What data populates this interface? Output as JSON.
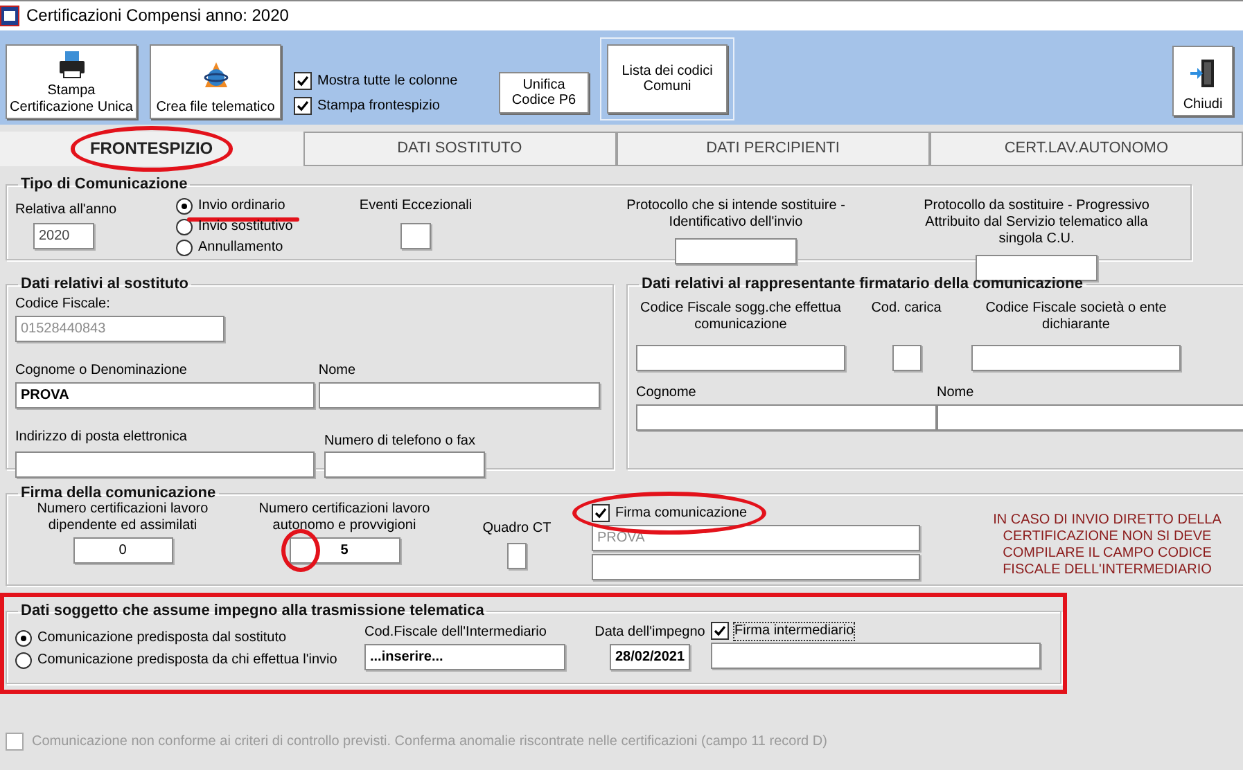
{
  "window": {
    "title": "Certificazioni Compensi anno: 2020"
  },
  "toolbar": {
    "buttons": [
      {
        "kind": "printer",
        "label": "Stampa Certificazione Unica"
      },
      {
        "kind": "telematic",
        "label": "Crea file telematico"
      }
    ],
    "options": [
      {
        "label": "Mostra tutte le colonne",
        "checked": true
      },
      {
        "label": "Stampa frontespizio",
        "checked": true
      }
    ],
    "actions": [
      {
        "label": "Unifica Codice P6"
      },
      {
        "label": "Lista dei codici Comuni"
      }
    ],
    "close": {
      "label": "Chiudi"
    }
  },
  "tabs": [
    {
      "label": "FRONTESPIZIO",
      "selected": true,
      "circled": true
    },
    {
      "label": "DATI SOSTITUTO",
      "selected": false
    },
    {
      "label": "DATI PERCIPIENTI",
      "selected": false
    },
    {
      "label": "CERT.LAV.AUTONOMO",
      "selected": false
    }
  ],
  "tipo_comunicazione": {
    "title": "Tipo di Comunicazione",
    "anno": {
      "label": "Relativa all'anno",
      "value": "2020"
    },
    "radios": [
      {
        "label": "Invio ordinario",
        "selected": true,
        "underlined": true
      },
      {
        "label": "Invio sostitutivo",
        "selected": false
      },
      {
        "label": "Annullamento",
        "selected": false
      }
    ],
    "eventi": {
      "label": "Eventi Eccezionali"
    },
    "protocollo": {
      "label": "Protocollo che si intende sostituire - Identificativo dell'invio"
    },
    "progressivo": {
      "label": "Protocollo da sostituire - Progressivo Attribuito dal Servizio telematico alla singola C.U."
    }
  },
  "sostituto": {
    "title": "Dati relativi al sostituto",
    "fields": [
      {
        "label": "Codice Fiscale:",
        "value": "01528440843",
        "disabled": true,
        "bold": false
      },
      {
        "label": "Cognome o Denominazione",
        "value": "PROVA",
        "disabled": false,
        "bold": true
      },
      {
        "label": "Nome"
      },
      {
        "label": "Indirizzo di posta elettronica"
      },
      {
        "label": "Numero di telefono o fax"
      }
    ]
  },
  "rappresentante": {
    "title": "Dati relativi al rappresentante firmatario della comunicazione",
    "fields": [
      {
        "label": "Codice Fiscale sogg.che effettua comunicazione"
      },
      {
        "label": "Cod. carica"
      },
      {
        "label": "Codice Fiscale società o ente dichiarante"
      },
      {
        "label": "Cognome"
      },
      {
        "label": "Nome"
      }
    ]
  },
  "firma": {
    "title": "Firma della comunicazione",
    "fields": [
      {
        "label": "Numero certificazioni lavoro dipendente ed assimilati",
        "value": "0",
        "bold": false
      },
      {
        "label": "Numero certificazioni lavoro autonomo e provvigioni",
        "value": "5",
        "bold": true,
        "circled": true
      },
      {
        "label": "Quadro CT"
      }
    ],
    "firma_check": {
      "label": "Firma comunicazione",
      "checked": true,
      "circled": true
    },
    "firma_values": [
      {
        "value": "PROVA",
        "disabled": true
      }
    ],
    "note": "IN CASO DI INVIO DIRETTO DELLA CERTIFICAZIONE NON SI DEVE COMPILARE IL CAMPO CODICE FISCALE DELL'INTERMEDIARIO"
  },
  "impegno": {
    "title": "Dati soggetto che assume impegno alla trasmissione telematica",
    "highlighted": true,
    "radios": [
      {
        "label": "Comunicazione predisposta dal sostituto",
        "selected": true
      },
      {
        "label": "Comunicazione predisposta da chi effettua l'invio",
        "selected": false
      }
    ],
    "intermediario": {
      "label": "Cod.Fiscale dell'Intermediario",
      "value": "...inserire..."
    },
    "data": {
      "label": "Data dell'impegno",
      "value": "28/02/2021"
    },
    "firma_check": {
      "label": "Firma intermediario",
      "checked": true,
      "focused": true
    }
  },
  "footer": {
    "label": "Comunicazione non conforme ai criteri di controllo previsti. Conferma anomalie riscontrate nelle certificazioni (campo 11 record D)",
    "checked": false,
    "disabled": true
  }
}
